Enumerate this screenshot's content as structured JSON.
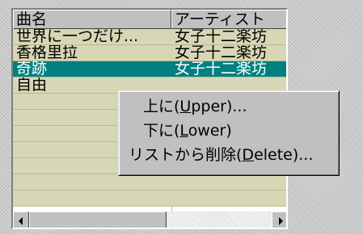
{
  "listview": {
    "columns": [
      "曲名",
      "アーティスト"
    ],
    "rows": [
      {
        "title": "世界に一つだけ...",
        "artist": "女子十二楽坊",
        "selected": false
      },
      {
        "title": "香格里拉",
        "artist": "女子十二楽坊",
        "selected": false
      },
      {
        "title": "奇跡",
        "artist": "女子十二楽坊",
        "selected": true
      },
      {
        "title": "自由",
        "artist": "",
        "selected": false
      },
      {
        "title": "",
        "artist": "",
        "selected": false
      },
      {
        "title": "",
        "artist": "",
        "selected": false
      },
      {
        "title": "",
        "artist": "",
        "selected": false
      },
      {
        "title": "",
        "artist": "",
        "selected": false
      },
      {
        "title": "",
        "artist": "",
        "selected": false
      },
      {
        "title": "",
        "artist": "",
        "selected": false
      },
      {
        "title": "",
        "artist": "",
        "selected": false
      }
    ]
  },
  "context_menu": {
    "items": [
      {
        "prefix": "上に(",
        "mnemonic": "U",
        "suffix": "pper)..."
      },
      {
        "prefix": "下に(",
        "mnemonic": "L",
        "suffix": "ower)"
      },
      {
        "prefix": "リストから削除(",
        "mnemonic": "D",
        "suffix": "elete)..."
      }
    ]
  },
  "colors": {
    "row_background": "#d7d7b6",
    "selected_background": "#008080",
    "menu_background": "#c0c0c0"
  },
  "icons": {
    "scroll_left": "arrow-left-icon",
    "scroll_right": "arrow-right-icon"
  }
}
